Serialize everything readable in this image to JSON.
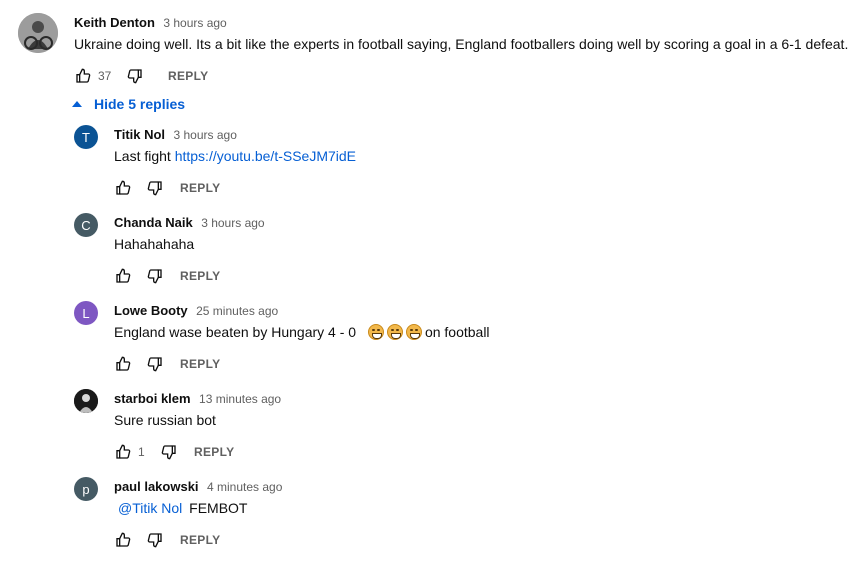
{
  "top_comment": {
    "author": "Keith Denton",
    "time": "3 hours ago",
    "text": "Ukraine doing well. Its a bit like the experts in football saying, England footballers doing well by scoring a goal in a 6-1 defeat.",
    "likes": "37",
    "reply_label": "REPLY"
  },
  "hide_replies": {
    "label": "Hide 5 replies"
  },
  "replies": [
    {
      "author": "Titik Nol",
      "time": "3 hours ago",
      "text": "Last fight ",
      "link": "https://youtu.be/t-SSeJM7idE",
      "likes": "",
      "reply_label": "REPLY",
      "avatar_letter": "T",
      "avatar_color": "#0b5394"
    },
    {
      "author": "Chanda Naik",
      "time": "3 hours ago",
      "text": "Hahahahaha",
      "likes": "",
      "reply_label": "REPLY",
      "avatar_letter": "C",
      "avatar_color": "#455a64"
    },
    {
      "author": "Lowe Booty",
      "time": "25 minutes ago",
      "text": "England wase beaten by Hungary 4 - 0",
      "text_after": "on football",
      "emoji_icon": "grinning-squinting-face-emoji",
      "likes": "",
      "reply_label": "REPLY",
      "avatar_letter": "L",
      "avatar_color": "#7e57c2"
    },
    {
      "author": "starboi klem",
      "time": "13 minutes ago",
      "text": "Sure russian bot",
      "likes": "1",
      "reply_label": "REPLY",
      "avatar_letter": "",
      "avatar_color": "#1a1a1a"
    },
    {
      "author": "paul lakowski",
      "time": "4 minutes ago",
      "mention": "@Titik Nol",
      "text": "FEMBOT",
      "likes": "",
      "reply_label": "REPLY",
      "avatar_letter": "p",
      "avatar_color": "#455a64"
    }
  ],
  "colors": {
    "link": "#065fd4",
    "secondary_text": "#606060",
    "primary_text": "#0f0f0f"
  }
}
